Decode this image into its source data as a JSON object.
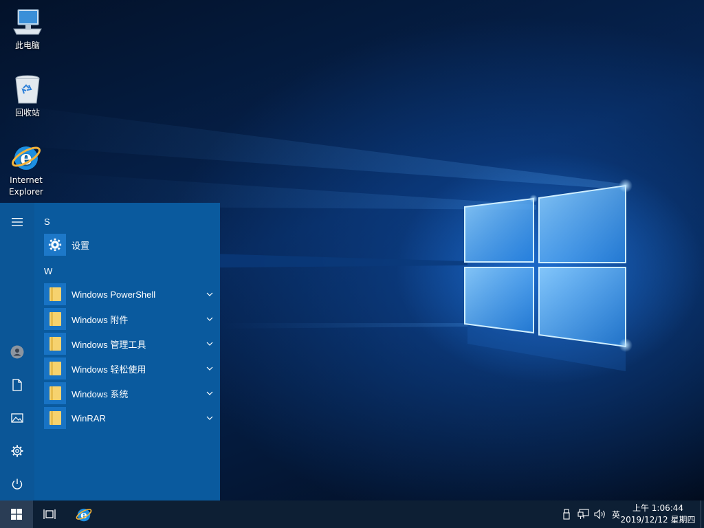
{
  "desktop": {
    "icons": [
      {
        "label": "此电脑",
        "icon": "computer-icon"
      },
      {
        "label": "回收站",
        "icon": "recycle-bin-icon"
      },
      {
        "label": "Internet Explorer",
        "icon": "internet-explorer-icon"
      }
    ]
  },
  "start_menu": {
    "rail": [
      {
        "icon": "hamburger-menu-icon"
      },
      {
        "icon": "user-avatar-icon"
      },
      {
        "icon": "documents-icon"
      },
      {
        "icon": "pictures-icon"
      },
      {
        "icon": "settings-gear-icon"
      },
      {
        "icon": "power-icon"
      }
    ],
    "groups": [
      {
        "header": "S",
        "apps": [
          {
            "label": "设置",
            "icon": "settings-gear-icon",
            "expandable": false
          }
        ]
      },
      {
        "header": "W",
        "apps": [
          {
            "label": "Windows PowerShell",
            "icon": "folder-icon",
            "expandable": true
          },
          {
            "label": "Windows 附件",
            "icon": "folder-icon",
            "expandable": true
          },
          {
            "label": "Windows 管理工具",
            "icon": "folder-icon",
            "expandable": true
          },
          {
            "label": "Windows 轻松使用",
            "icon": "folder-icon",
            "expandable": true
          },
          {
            "label": "Windows 系统",
            "icon": "folder-icon",
            "expandable": true
          },
          {
            "label": "WinRAR",
            "icon": "folder-icon",
            "expandable": true
          }
        ]
      }
    ],
    "accent_color": "#0a5a9e"
  },
  "taskbar": {
    "start_icon": "windows-logo-icon",
    "task_view_icon": "task-view-icon",
    "pinned": [
      {
        "icon": "internet-explorer-icon"
      }
    ],
    "tray": {
      "usb_icon": "usb-drive-icon",
      "network_icon": "network-icon",
      "volume_icon": "volume-icon",
      "ime_label": "英"
    },
    "clock": {
      "time": "上午 1:06:44",
      "date": "2019/12/12 星期四"
    }
  }
}
